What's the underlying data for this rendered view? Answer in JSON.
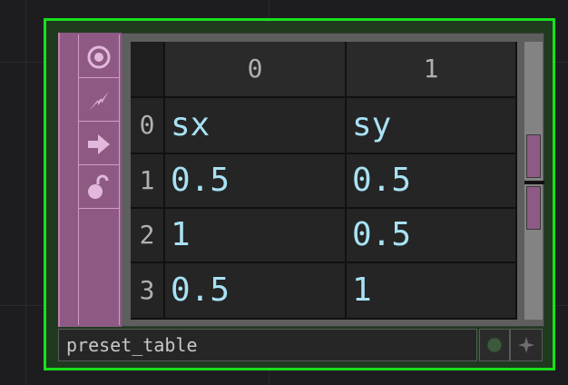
{
  "node": {
    "name": "preset_table",
    "frame_color": "#19e01c",
    "flag_color": "#8e5a84",
    "text_color": "#a8e2f4"
  },
  "flags": [
    {
      "icon": "bypass-icon"
    },
    {
      "icon": "lock-flag-icon"
    },
    {
      "icon": "display-arrow-icon"
    },
    {
      "icon": "clone-lock-icon"
    }
  ],
  "table": {
    "columns": [
      "0",
      "1"
    ],
    "row_labels": [
      "0",
      "1",
      "2",
      "3"
    ],
    "rows": [
      [
        "sx",
        "sy"
      ],
      [
        "0.5",
        "0.5"
      ],
      [
        "1",
        "0.5"
      ],
      [
        "0.5",
        "1"
      ]
    ]
  },
  "footer": {
    "viewer_icon": "viewer-active-dot-icon",
    "pin_icon": "pin-plus-icon"
  }
}
